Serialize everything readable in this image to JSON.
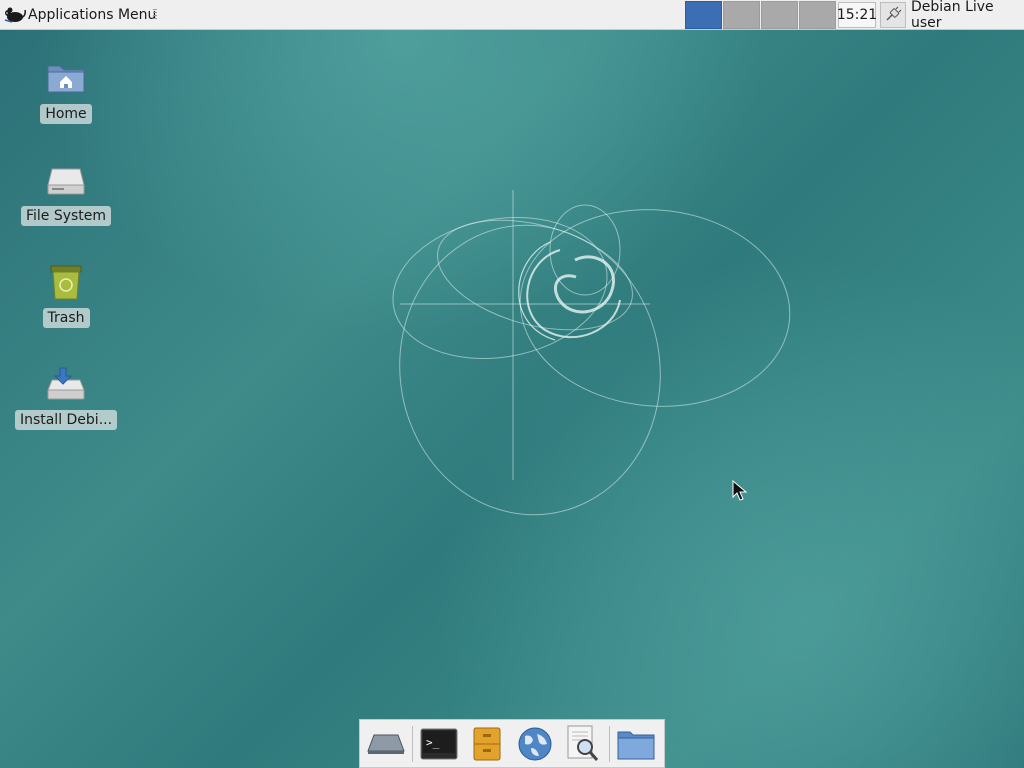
{
  "top_panel": {
    "app_menu_label": "Applications Menu",
    "workspaces": [
      {
        "name": "workspace-1",
        "active": true
      },
      {
        "name": "workspace-2",
        "active": false
      },
      {
        "name": "workspace-3",
        "active": false
      },
      {
        "name": "workspace-4",
        "active": false
      }
    ],
    "clock": "15:21",
    "user": "Debian Live user"
  },
  "desktop_icons": [
    {
      "label": "Home",
      "icon": "home-folder-icon"
    },
    {
      "label": "File System",
      "icon": "drive-icon"
    },
    {
      "label": "Trash",
      "icon": "trash-icon"
    },
    {
      "label": "Install Debi...",
      "icon": "install-icon"
    }
  ],
  "dock": {
    "launchers": [
      "show-desktop-icon",
      "terminal-icon",
      "file-cabinet-icon",
      "web-browser-icon",
      "search-icon",
      "folder-icon"
    ]
  },
  "colors": {
    "workspace_active": "#3c6eb4",
    "desktop_teal": "#3e8b8a"
  }
}
